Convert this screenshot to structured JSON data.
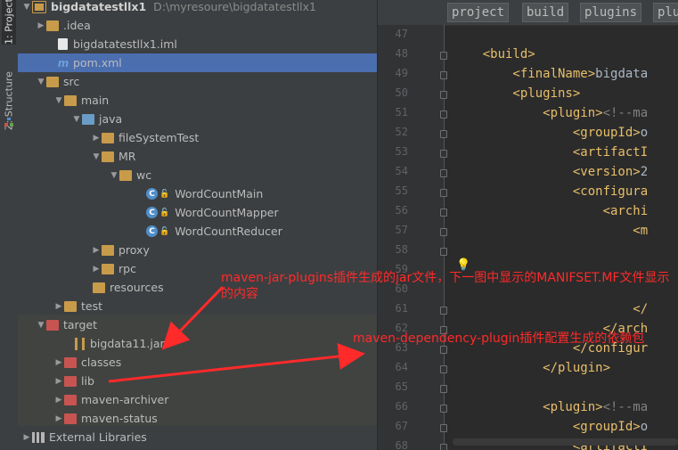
{
  "tool_strip": {
    "project_tab": "1: Project",
    "structure_tab": "Z: Structure"
  },
  "tree": {
    "root": {
      "name": "bigdatatestllx1",
      "path": "D:\\myresoure\\bigdatatestllx1"
    },
    "items": [
      {
        "label": "bigdatatestllx1"
      },
      {
        "label": ".idea"
      },
      {
        "label": "bigdatatestllx1.iml"
      },
      {
        "label": "pom.xml"
      },
      {
        "label": "src"
      },
      {
        "label": "main"
      },
      {
        "label": "java"
      },
      {
        "label": "fileSystemTest"
      },
      {
        "label": "MR"
      },
      {
        "label": "wc"
      },
      {
        "label": "WordCountMain"
      },
      {
        "label": "WordCountMapper"
      },
      {
        "label": "WordCountReducer"
      },
      {
        "label": "proxy"
      },
      {
        "label": "rpc"
      },
      {
        "label": "resources"
      },
      {
        "label": "test"
      },
      {
        "label": "target"
      },
      {
        "label": "bigdata11.jar"
      },
      {
        "label": "classes"
      },
      {
        "label": "lib"
      },
      {
        "label": "maven-archiver"
      },
      {
        "label": "maven-status"
      },
      {
        "label": "External Libraries"
      }
    ],
    "class_badge": "C"
  },
  "editor": {
    "breadcrumbs": [
      "project",
      "build",
      "plugins",
      "plu"
    ],
    "line_numbers": [
      "47",
      "48",
      "49",
      "50",
      "51",
      "52",
      "53",
      "54",
      "55",
      "56",
      "57",
      "58",
      "59",
      "60",
      "61",
      "62",
      "63",
      "64",
      "65",
      "66",
      "67",
      "68"
    ],
    "lines": [
      "",
      "    <build>",
      "        <finalName>bigdata",
      "        <plugins>",
      "            <plugin><!--ma",
      "                <groupId>o",
      "                <artifactI",
      "                <version>2",
      "                <configura",
      "                    <archi",
      "                        <m",
      "",
      "",
      "",
      "                        </",
      "                    </arch",
      "                </configur",
      "            </plugin>",
      "",
      "            <plugin><!--ma",
      "                <groupId>o",
      "                <artifactI"
    ]
  },
  "annotations": {
    "jar_note": "maven-jar-plugins插件生成的jar文件，下一图中显示的MANIFSET.MF文件显示的内容",
    "dep_note": "maven-dependency-plugin插件配置生成的依赖包"
  },
  "colors": {
    "annotation": "#ff2a2a",
    "selection": "#4b6eaf",
    "tag": "#e8bf6a"
  }
}
